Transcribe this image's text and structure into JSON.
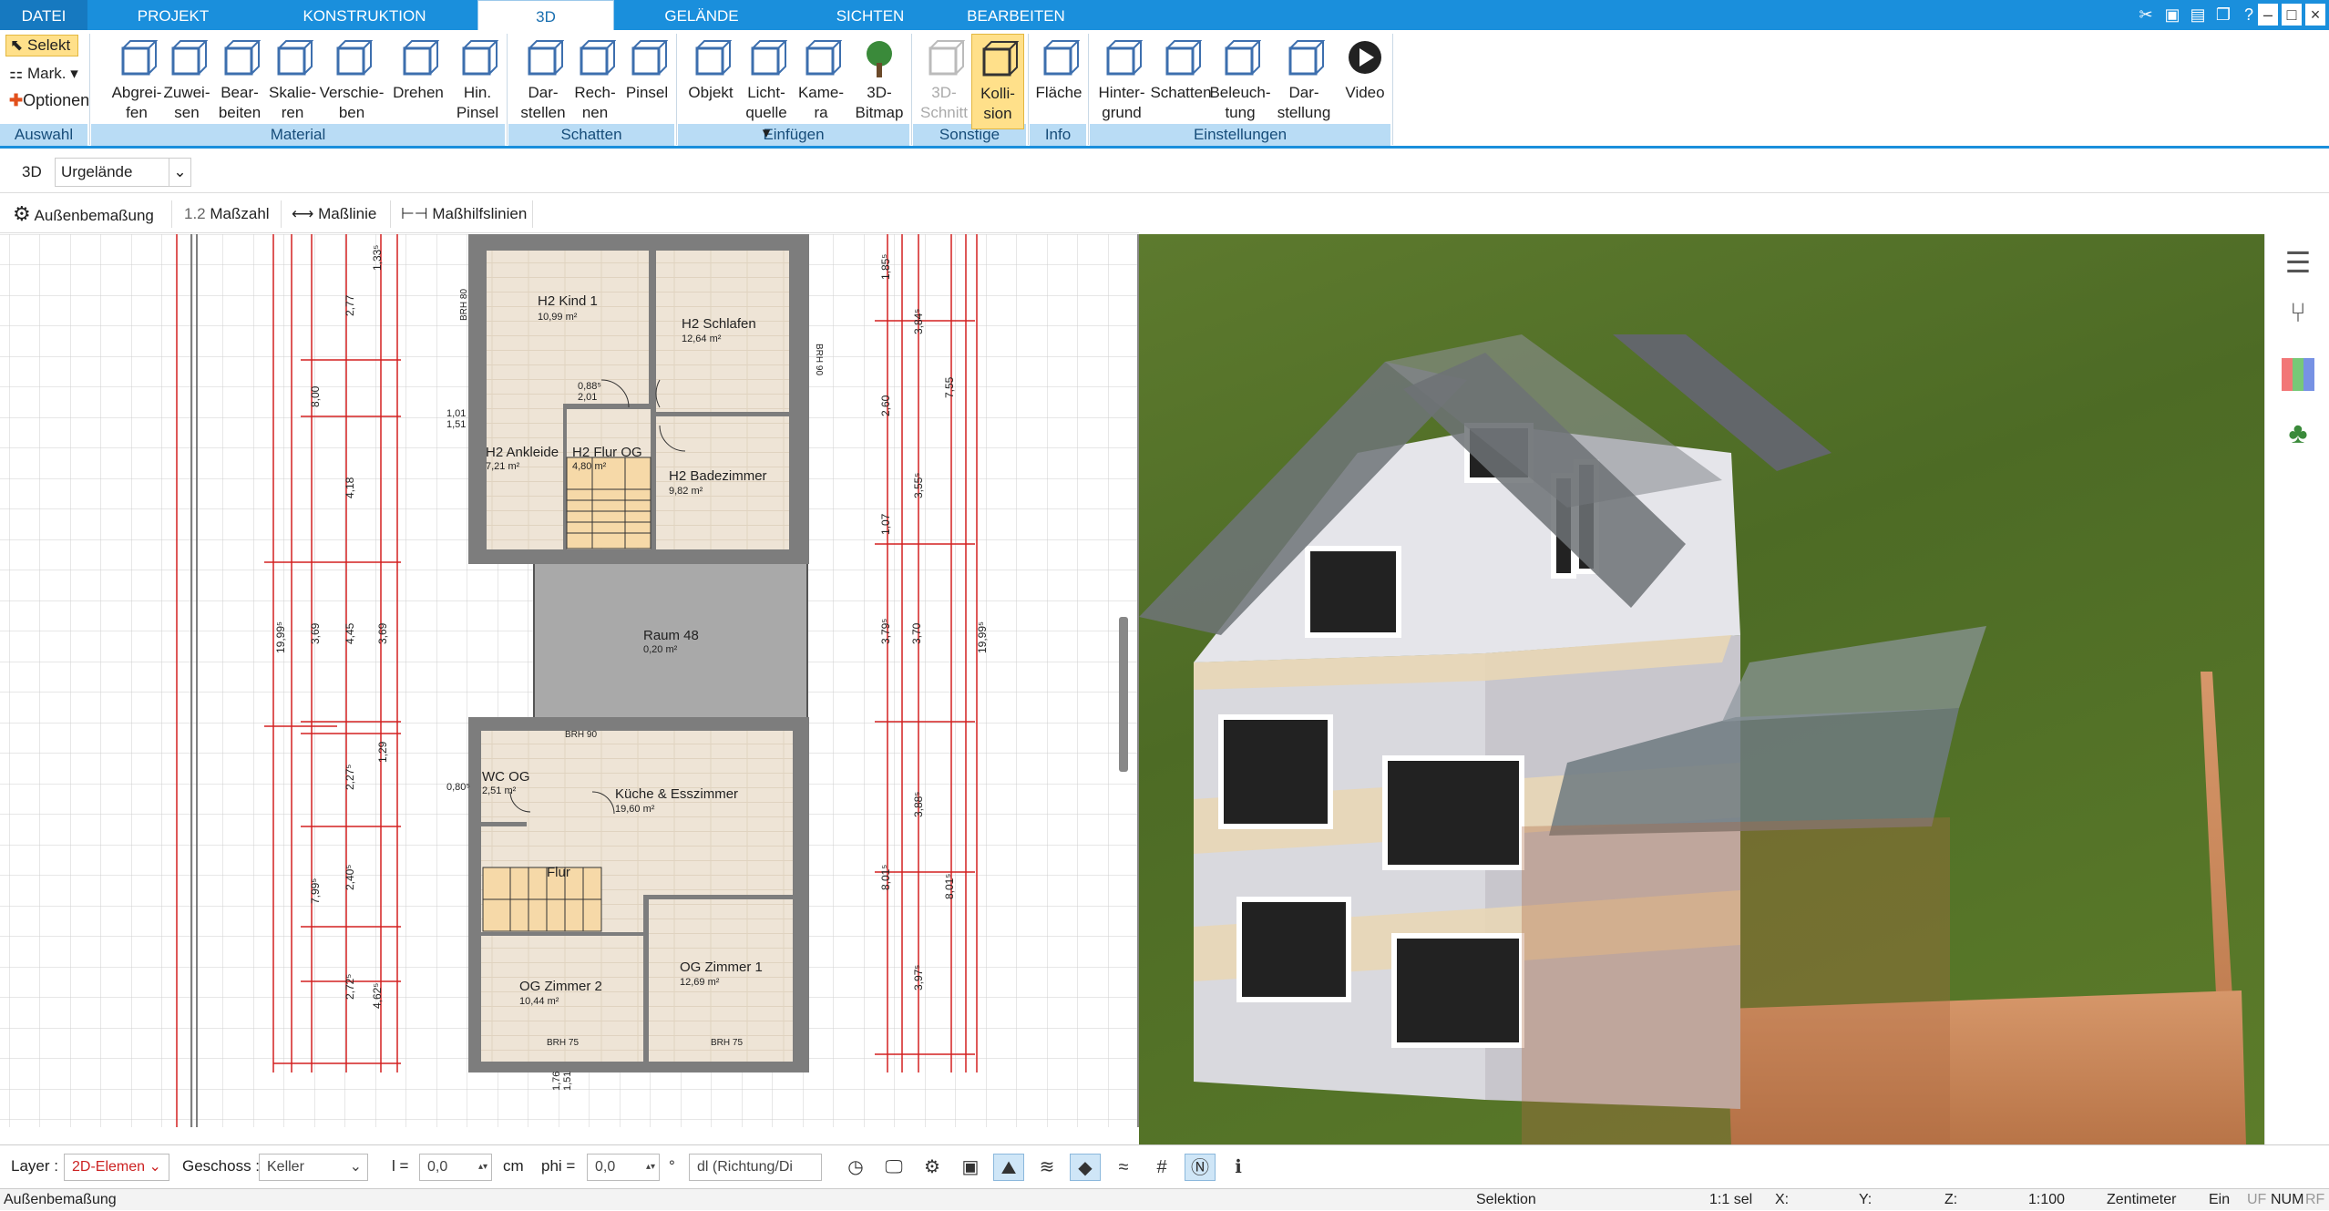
{
  "menu": {
    "tabs": [
      "DATEI",
      "PROJEKT",
      "KONSTRUKTION",
      "3D",
      "GELÄNDE",
      "SICHTEN",
      "BEARBEITEN"
    ],
    "active": "3D"
  },
  "ribbon": {
    "auswahl": {
      "selekt": "Selekt",
      "mark": "Mark.",
      "optionen": "Optionen",
      "group": "Auswahl"
    },
    "material": {
      "group": "Material",
      "buttons": [
        {
          "l1": "Abgrei-",
          "l2": "fen"
        },
        {
          "l1": "Zuwei-",
          "l2": "sen"
        },
        {
          "l1": "Bear-",
          "l2": "beiten"
        },
        {
          "l1": "Skalie-",
          "l2": "ren"
        },
        {
          "l1": "Verschie-",
          "l2": "ben"
        },
        {
          "l1": "Drehen",
          "l2": ""
        },
        {
          "l1": "Hin.",
          "l2": "Pinsel"
        }
      ]
    },
    "schatten": {
      "group": "Schatten",
      "buttons": [
        {
          "l1": "Dar-",
          "l2": "stellen"
        },
        {
          "l1": "Rech-",
          "l2": "nen"
        },
        {
          "l1": "Pinsel",
          "l2": ""
        }
      ]
    },
    "einfuegen": {
      "group": "Einfügen",
      "buttons": [
        {
          "l1": "Objekt",
          "l2": ""
        },
        {
          "l1": "Licht-",
          "l2": "quelle ▾"
        },
        {
          "l1": "Kame-",
          "l2": "ra"
        },
        {
          "l1": "3D-",
          "l2": "Bitmap"
        }
      ]
    },
    "sonstige": {
      "group": "Sonstige",
      "buttons": [
        {
          "l1": "3D-",
          "l2": "Schnitt"
        },
        {
          "l1": "Kolli-",
          "l2": "sion"
        }
      ]
    },
    "info": {
      "group": "Info",
      "buttons": [
        {
          "l1": "Fläche",
          "l2": ""
        }
      ]
    },
    "einstellungen": {
      "group": "Einstellungen",
      "buttons": [
        {
          "l1": "Hinter-",
          "l2": "grund"
        },
        {
          "l1": "Schatten",
          "l2": ""
        },
        {
          "l1": "Beleuch-",
          "l2": "tung"
        },
        {
          "l1": "Dar-",
          "l2": "stellung"
        },
        {
          "l1": "Video",
          "l2": ""
        }
      ]
    }
  },
  "toolbar2": {
    "mode": "3D",
    "terrain": "Urgelände"
  },
  "toolbar3": {
    "items": [
      "Außenbemaßung",
      "1.2",
      "Maßzahl",
      "Maßlinie",
      "Maßhilfslinien"
    ]
  },
  "rooms": [
    {
      "name": "H2 Kind 1",
      "area": "10,99 m²"
    },
    {
      "name": "H2 Schlafen",
      "area": "12,64 m²"
    },
    {
      "name": "H2 Ankleide",
      "area": "7,21 m²"
    },
    {
      "name": "H2 Flur OG",
      "area": "4,80 m²"
    },
    {
      "name": "H2 Badezimmer",
      "area": "9,82 m²"
    },
    {
      "name": "Raum 48",
      "area": "0,20 m²"
    },
    {
      "name": "WC OG",
      "area": "2,51 m²"
    },
    {
      "name": "Küche & Esszimmer",
      "area": "19,60 m²"
    },
    {
      "name": "Flur",
      "area": ""
    },
    {
      "name": "OG Zimmer 2",
      "area": "10,44 m²"
    },
    {
      "name": "OG Zimmer 1",
      "area": "12,69 m²"
    }
  ],
  "dims": {
    "left_a": [
      "19,99⁵",
      "7,99⁵",
      "8,00"
    ],
    "left_b": [
      "2,77",
      "4,18",
      "3,69",
      "2,27⁵",
      "2,40⁵",
      "2,72⁵",
      "1,33⁵"
    ],
    "left_c": [
      "4,45",
      "4,62⁵",
      "3,69",
      "1,29"
    ],
    "right_a": [
      "19,99⁵",
      "7,55",
      "3,70",
      "8,01⁵"
    ],
    "right_b": [
      "3,84⁵",
      "3,55⁵",
      "3,79⁵",
      "3,97⁵",
      "3,88⁵"
    ],
    "right_c": [
      "2,60",
      "1,07",
      "8,01⁵",
      "1,85⁵"
    ],
    "brh": [
      "BRH 90",
      "BRH 80",
      "BRH 75",
      "BRH 75",
      "BRH 90"
    ],
    "open": [
      "1,01",
      "1,51",
      "0,88⁵",
      "2,01",
      "1,76",
      "1,51",
      "0,80⁵"
    ]
  },
  "statusbar": {
    "layer_label": "Layer :",
    "layer_value": "2D-Elemen",
    "geschoss_label": "Geschoss :",
    "geschoss_value": "Keller",
    "l_label": "l =",
    "l_value": "0,0",
    "l_unit": "cm",
    "phi_label": "phi =",
    "phi_value": "0,0",
    "phi_unit": "°",
    "dl_value": "dl (Richtung/Di"
  },
  "statusbar2": {
    "left": "Außenbemaßung",
    "mode": "Selektion",
    "sel": "1:1 sel",
    "x": "X:",
    "y": "Y:",
    "z": "Z:",
    "scale": "1:100",
    "unit": "Zentimeter",
    "ein": "Ein",
    "uf": "UF",
    "num": "NUM",
    "rf": "RF"
  },
  "colors": {
    "accent": "#1a8fdc",
    "group_bg": "#b9dcf5",
    "dim_red": "#d22",
    "floor": "#ece3d6",
    "wall": "#7a7a7a",
    "grass": "#5a7a2c",
    "fence": "#c98a55"
  }
}
